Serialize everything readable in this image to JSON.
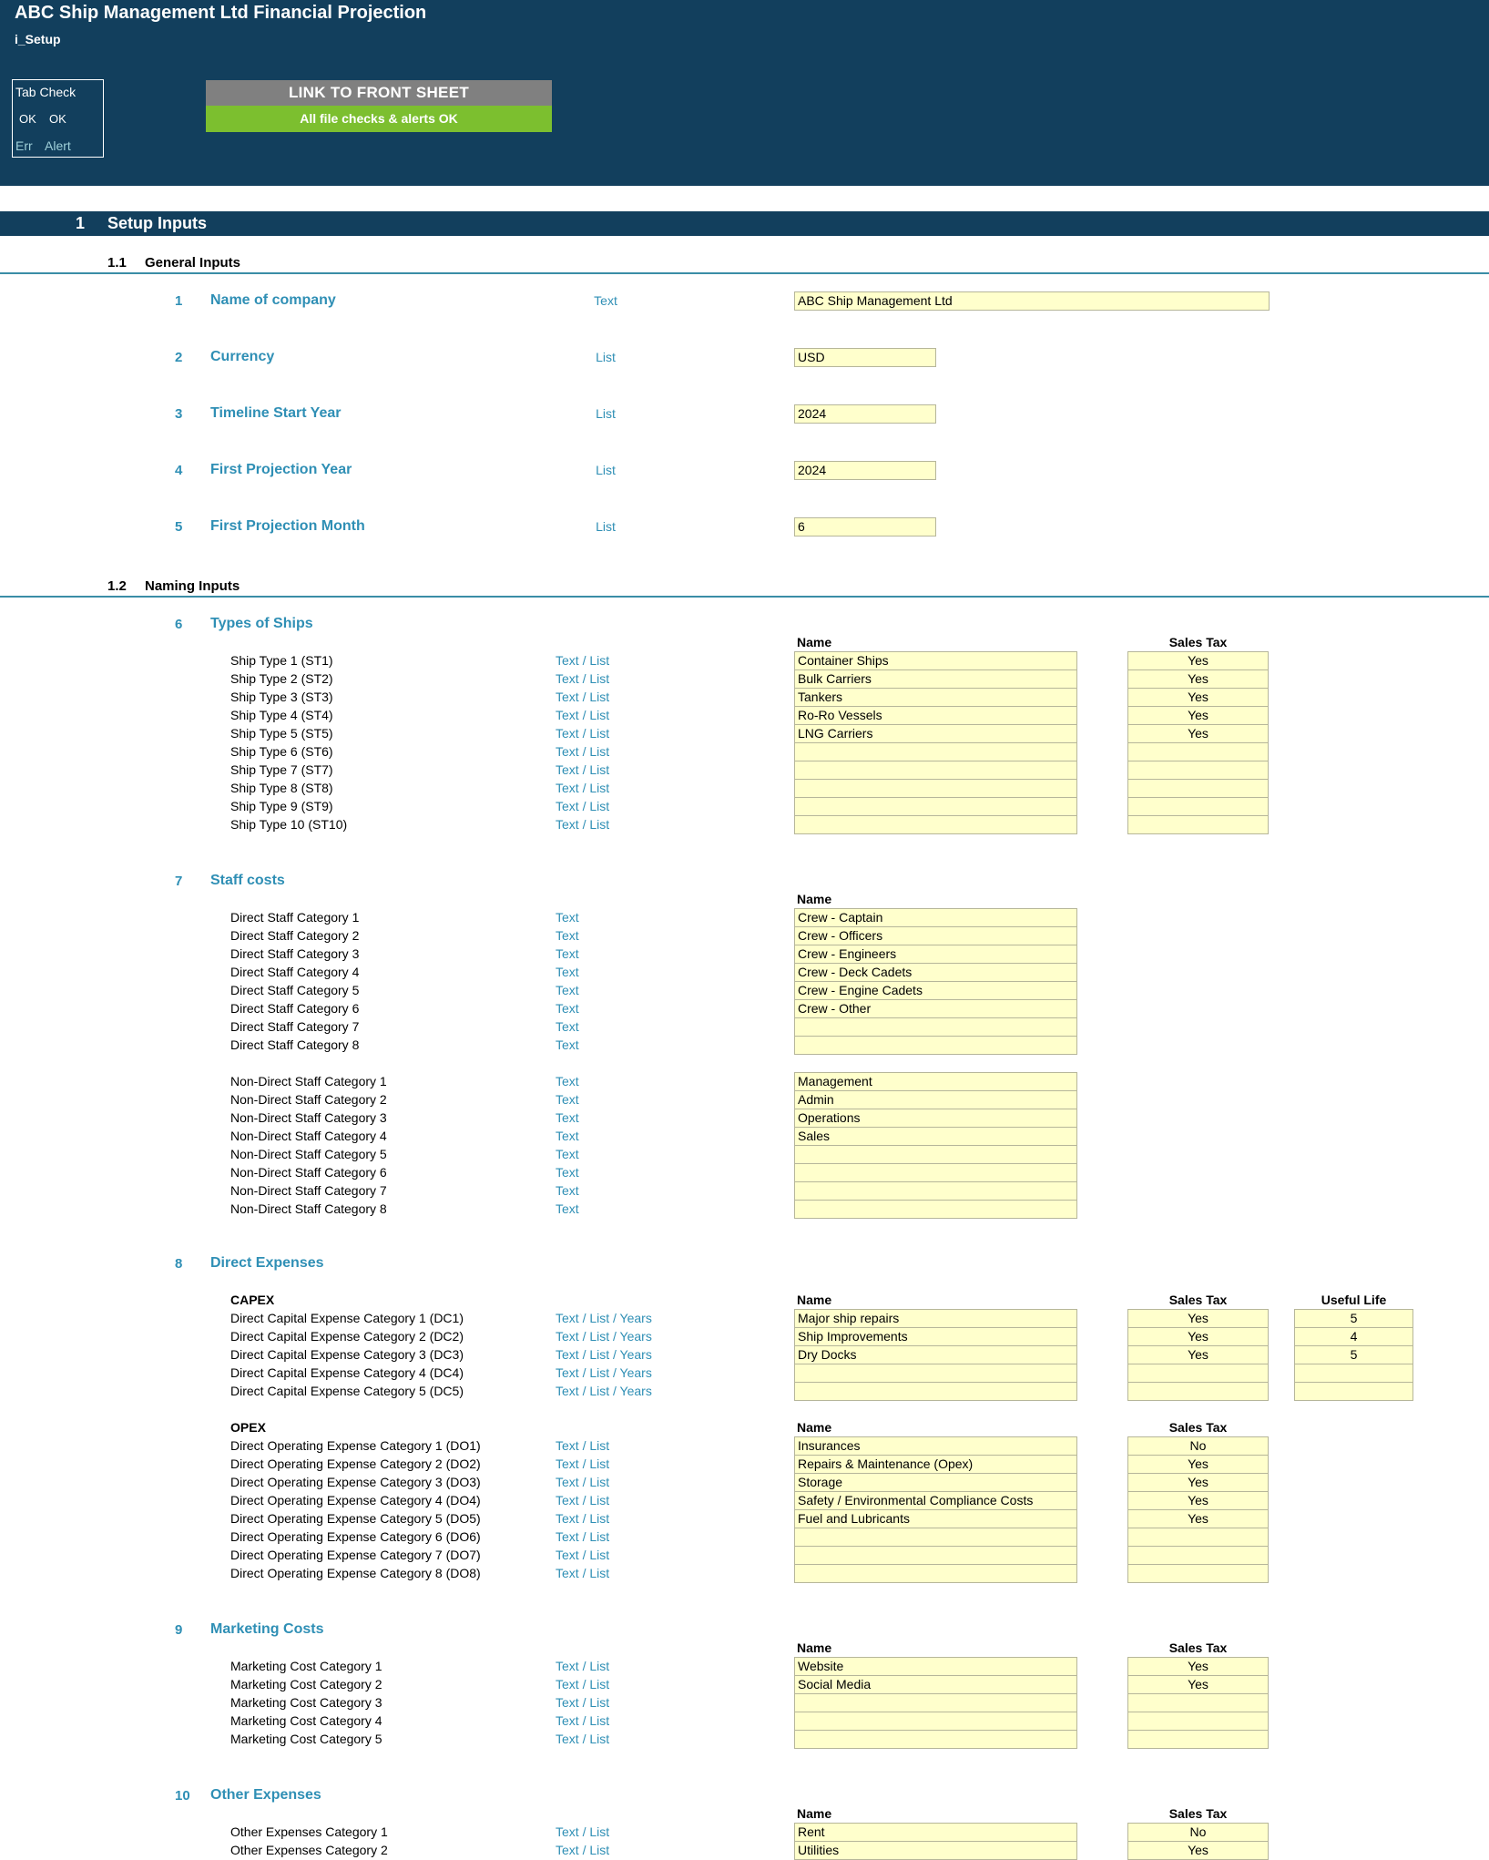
{
  "header": {
    "title": "ABC Ship Management Ltd Financial Projection",
    "sheet": "i_Setup",
    "tab_check": {
      "title": "Tab Check",
      "ok1": "OK",
      "ok2": "OK",
      "err": "Err",
      "alert": "Alert"
    },
    "link_button": "LINK TO FRONT SHEET",
    "checks_status": "All file checks & alerts OK"
  },
  "section": {
    "num": "1",
    "title": "Setup Inputs"
  },
  "general": {
    "num": "1.1",
    "title": "General Inputs",
    "items": [
      {
        "num": "1",
        "label": "Name of company",
        "type": "Text",
        "value": "ABC Ship Management Ltd"
      },
      {
        "num": "2",
        "label": "Currency",
        "type": "List",
        "value": "USD"
      },
      {
        "num": "3",
        "label": "Timeline Start Year",
        "type": "List",
        "value": "2024"
      },
      {
        "num": "4",
        "label": "First Projection Year",
        "type": "List",
        "value": "2024"
      },
      {
        "num": "5",
        "label": "First Projection Month",
        "type": "List",
        "value": "6"
      }
    ]
  },
  "naming": {
    "num": "1.2",
    "title": "Naming Inputs"
  },
  "ships": {
    "num": "6",
    "title": "Types of Ships",
    "col_name": "Name",
    "col_tax": "Sales Tax",
    "rows": [
      {
        "label": "Ship Type 1 (ST1)",
        "type": "Text / List",
        "name": "Container Ships",
        "tax": "Yes"
      },
      {
        "label": "Ship Type 2 (ST2)",
        "type": "Text / List",
        "name": "Bulk Carriers",
        "tax": "Yes"
      },
      {
        "label": "Ship Type 3 (ST3)",
        "type": "Text / List",
        "name": "Tankers",
        "tax": "Yes"
      },
      {
        "label": "Ship Type 4 (ST4)",
        "type": "Text / List",
        "name": "Ro-Ro Vessels",
        "tax": "Yes"
      },
      {
        "label": "Ship Type 5 (ST5)",
        "type": "Text / List",
        "name": "LNG Carriers",
        "tax": "Yes"
      },
      {
        "label": "Ship Type 6 (ST6)",
        "type": "Text / List",
        "name": "",
        "tax": ""
      },
      {
        "label": "Ship Type 7 (ST7)",
        "type": "Text / List",
        "name": "",
        "tax": ""
      },
      {
        "label": "Ship Type 8 (ST8)",
        "type": "Text / List",
        "name": "",
        "tax": ""
      },
      {
        "label": "Ship Type 9 (ST9)",
        "type": "Text / List",
        "name": "",
        "tax": ""
      },
      {
        "label": "Ship Type 10 (ST10)",
        "type": "Text / List",
        "name": "",
        "tax": ""
      }
    ]
  },
  "staff": {
    "num": "7",
    "title": "Staff costs",
    "col_name": "Name",
    "direct": [
      {
        "label": "Direct Staff Category 1",
        "type": "Text",
        "name": "Crew - Captain"
      },
      {
        "label": "Direct Staff Category 2",
        "type": "Text",
        "name": "Crew - Officers"
      },
      {
        "label": "Direct Staff Category 3",
        "type": "Text",
        "name": "Crew - Engineers"
      },
      {
        "label": "Direct Staff Category 4",
        "type": "Text",
        "name": "Crew - Deck Cadets"
      },
      {
        "label": "Direct Staff Category 5",
        "type": "Text",
        "name": "Crew - Engine Cadets"
      },
      {
        "label": "Direct Staff Category 6",
        "type": "Text",
        "name": "Crew - Other"
      },
      {
        "label": "Direct Staff Category 7",
        "type": "Text",
        "name": ""
      },
      {
        "label": "Direct Staff Category 8",
        "type": "Text",
        "name": ""
      }
    ],
    "nondirect": [
      {
        "label": "Non-Direct Staff Category 1",
        "type": "Text",
        "name": "Management"
      },
      {
        "label": "Non-Direct Staff Category 2",
        "type": "Text",
        "name": "Admin"
      },
      {
        "label": "Non-Direct Staff Category 3",
        "type": "Text",
        "name": "Operations"
      },
      {
        "label": "Non-Direct Staff Category 4",
        "type": "Text",
        "name": "Sales"
      },
      {
        "label": "Non-Direct Staff Category 5",
        "type": "Text",
        "name": ""
      },
      {
        "label": "Non-Direct Staff Category 6",
        "type": "Text",
        "name": ""
      },
      {
        "label": "Non-Direct Staff Category 7",
        "type": "Text",
        "name": ""
      },
      {
        "label": "Non-Direct Staff Category 8",
        "type": "Text",
        "name": ""
      }
    ]
  },
  "direct_expenses": {
    "num": "8",
    "title": "Direct Expenses",
    "capex": {
      "title": "CAPEX",
      "col_name": "Name",
      "col_tax": "Sales Tax",
      "col_life": "Useful Life",
      "rows": [
        {
          "label": "Direct Capital Expense Category 1 (DC1)",
          "type": "Text / List / Years",
          "name": "Major ship repairs",
          "tax": "Yes",
          "life": "5"
        },
        {
          "label": "Direct Capital Expense Category 2 (DC2)",
          "type": "Text / List / Years",
          "name": "Ship Improvements",
          "tax": "Yes",
          "life": "4"
        },
        {
          "label": "Direct Capital Expense Category 3 (DC3)",
          "type": "Text / List / Years",
          "name": "Dry Docks",
          "tax": "Yes",
          "life": "5"
        },
        {
          "label": "Direct Capital Expense Category 4 (DC4)",
          "type": "Text / List / Years",
          "name": "",
          "tax": "",
          "life": ""
        },
        {
          "label": "Direct Capital Expense Category 5 (DC5)",
          "type": "Text / List / Years",
          "name": "",
          "tax": "",
          "life": ""
        }
      ]
    },
    "opex": {
      "title": "OPEX",
      "col_name": "Name",
      "col_tax": "Sales Tax",
      "rows": [
        {
          "label": "Direct Operating Expense Category 1 (DO1)",
          "type": "Text / List",
          "name": "Insurances",
          "tax": "No"
        },
        {
          "label": "Direct Operating Expense Category 2 (DO2)",
          "type": "Text / List",
          "name": "Repairs & Maintenance (Opex)",
          "tax": "Yes"
        },
        {
          "label": "Direct Operating Expense Category 3 (DO3)",
          "type": "Text / List",
          "name": "Storage",
          "tax": "Yes"
        },
        {
          "label": "Direct Operating Expense Category 4 (DO4)",
          "type": "Text / List",
          "name": "Safety / Environmental Compliance Costs",
          "tax": "Yes"
        },
        {
          "label": "Direct Operating Expense Category 5 (DO5)",
          "type": "Text / List",
          "name": "Fuel and Lubricants",
          "tax": "Yes"
        },
        {
          "label": "Direct Operating Expense Category 6 (DO6)",
          "type": "Text / List",
          "name": "",
          "tax": ""
        },
        {
          "label": "Direct Operating Expense Category 7 (DO7)",
          "type": "Text / List",
          "name": "",
          "tax": ""
        },
        {
          "label": "Direct Operating Expense Category 8 (DO8)",
          "type": "Text / List",
          "name": "",
          "tax": ""
        }
      ]
    }
  },
  "marketing": {
    "num": "9",
    "title": "Marketing Costs",
    "col_name": "Name",
    "col_tax": "Sales Tax",
    "rows": [
      {
        "label": "Marketing Cost Category 1",
        "type": "Text / List",
        "name": "Website",
        "tax": "Yes"
      },
      {
        "label": "Marketing Cost Category 2",
        "type": "Text / List",
        "name": "Social Media",
        "tax": "Yes"
      },
      {
        "label": "Marketing Cost Category 3",
        "type": "Text / List",
        "name": "",
        "tax": ""
      },
      {
        "label": "Marketing Cost Category 4",
        "type": "Text / List",
        "name": "",
        "tax": ""
      },
      {
        "label": "Marketing Cost Category 5",
        "type": "Text / List",
        "name": "",
        "tax": ""
      }
    ]
  },
  "other": {
    "num": "10",
    "title": "Other Expenses",
    "col_name": "Name",
    "col_tax": "Sales Tax",
    "rows": [
      {
        "label": "Other Expenses Category 1",
        "type": "Text / List",
        "name": "Rent",
        "tax": "No"
      },
      {
        "label": "Other Expenses Category 2",
        "type": "Text / List",
        "name": "Utilities",
        "tax": "Yes"
      }
    ]
  },
  "colors": {
    "header_bg": "#123f5d",
    "accent": "#2f8fb5",
    "input_bg": "#ffffcc",
    "ok_green": "#7cbf2f",
    "button_grey": "#808080"
  }
}
